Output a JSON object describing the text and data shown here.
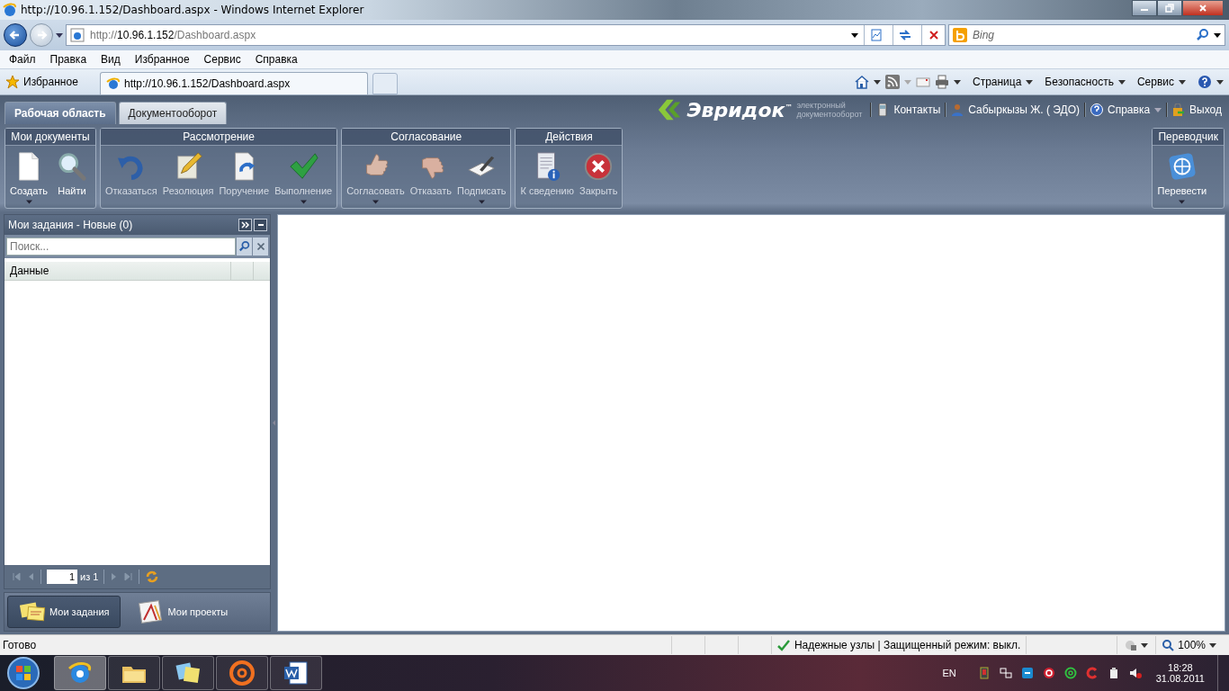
{
  "window": {
    "title": "http://10.96.1.152/Dashboard.aspx - Windows Internet Explorer"
  },
  "address_bar": {
    "url_dim": "http://",
    "url_host": "10.96.1.152",
    "url_path": "/Dashboard.aspx",
    "search_placeholder": "Bing"
  },
  "menu": [
    "Файл",
    "Правка",
    "Вид",
    "Избранное",
    "Сервис",
    "Справка"
  ],
  "favorites_bar": {
    "label": "Избранное",
    "tab": "http://10.96.1.152/Dashboard.aspx"
  },
  "command_bar": [
    "Страница",
    "Безопасность",
    "Сервис"
  ],
  "app": {
    "tabs": [
      {
        "label": "Рабочая область",
        "selected": true
      },
      {
        "label": "Документооборот",
        "selected": false
      }
    ],
    "logo": {
      "name": "Эвридок",
      "mark": "™",
      "tagline_1": "электронный",
      "tagline_2": "документооборот"
    },
    "header_links": [
      {
        "kind": "phone",
        "label": "Контакты",
        "dropdown": false
      },
      {
        "kind": "user",
        "label": "Сабыркызы Ж. ( ЭДО)",
        "dropdown": false
      },
      {
        "kind": "help",
        "label": "Справка",
        "dropdown": true
      },
      {
        "kind": "exit",
        "label": "Выход",
        "dropdown": false
      }
    ],
    "ribbon": [
      {
        "title": "Мои документы",
        "buttons": [
          {
            "kind": "page",
            "label": "Создать",
            "disabled": false,
            "dropdown": true
          },
          {
            "kind": "search",
            "label": "Найти",
            "disabled": false,
            "dropdown": false
          }
        ]
      },
      {
        "title": "Рассмотрение",
        "buttons": [
          {
            "kind": "undo",
            "label": "Отказаться",
            "disabled": true,
            "dropdown": false
          },
          {
            "kind": "pencil",
            "label": "Резолюция",
            "disabled": true,
            "dropdown": false
          },
          {
            "kind": "forward",
            "label": "Поручение",
            "disabled": true,
            "dropdown": false
          },
          {
            "kind": "check",
            "label": "Выполнение",
            "disabled": true,
            "dropdown": true
          }
        ]
      },
      {
        "title": "Согласование",
        "buttons": [
          {
            "kind": "thumb-up",
            "label": "Согласовать",
            "disabled": true,
            "dropdown": true
          },
          {
            "kind": "thumb-down",
            "label": "Отказать",
            "disabled": true,
            "dropdown": false
          },
          {
            "kind": "sign",
            "label": "Подписать",
            "disabled": true,
            "dropdown": true
          }
        ]
      },
      {
        "title": "Действия",
        "buttons": [
          {
            "kind": "info",
            "label": "К сведению",
            "disabled": true,
            "dropdown": false
          },
          {
            "kind": "close",
            "label": "Закрыть",
            "disabled": true,
            "dropdown": false
          }
        ]
      }
    ],
    "ribbon_right": {
      "title": "Переводчик",
      "buttons": [
        {
          "kind": "globe",
          "label": "Перевести",
          "disabled": false,
          "dropdown": true
        }
      ]
    },
    "tasks_panel": {
      "title": "Мои задания - Новые (0)",
      "search_placeholder": "Поиск...",
      "column": "Данные",
      "page": "1",
      "page_total": "из 1"
    },
    "nav": [
      {
        "kind": "notes",
        "label": "Мои задания",
        "selected": true
      },
      {
        "kind": "drawing",
        "label": "Мои проекты",
        "selected": false
      }
    ]
  },
  "status_bar": {
    "text": "Готово",
    "security": "Надежные узлы | Защищенный режим: выкл.",
    "zoom": "100%"
  },
  "taskbar": {
    "apps": [
      {
        "kind": "ie",
        "selected": true
      },
      {
        "kind": "folder",
        "selected": false
      },
      {
        "kind": "notes",
        "selected": false
      },
      {
        "kind": "mail",
        "selected": false
      },
      {
        "kind": "word",
        "selected": false
      }
    ],
    "language": "EN",
    "time": "18:28",
    "date": "31.08.2011"
  }
}
